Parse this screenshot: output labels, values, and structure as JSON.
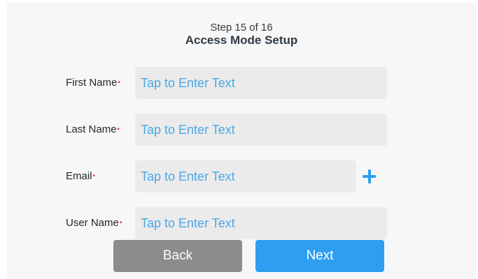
{
  "header": {
    "step": "Step 15 of 16",
    "title": "Access Mode Setup"
  },
  "form": {
    "required_marker": "•",
    "fields": [
      {
        "label": "First Name",
        "value": "",
        "placeholder": "Tap to Enter Text"
      },
      {
        "label": "Last Name",
        "value": "",
        "placeholder": "Tap to Enter Text"
      },
      {
        "label": "Email",
        "value": "",
        "placeholder": "Tap to Enter Text"
      },
      {
        "label": "User Name",
        "value": "",
        "placeholder": "Tap to Enter Text"
      }
    ],
    "add_email_icon": "plus-icon"
  },
  "footer": {
    "back_label": "Back",
    "next_label": "Next"
  },
  "colors": {
    "accent": "#2e9ff0",
    "placeholder": "#4ba7e6",
    "required": "#e5322d",
    "back_button": "#8c8c8c",
    "field_background": "#ebebeb",
    "screen_background": "#f7f7f7"
  }
}
